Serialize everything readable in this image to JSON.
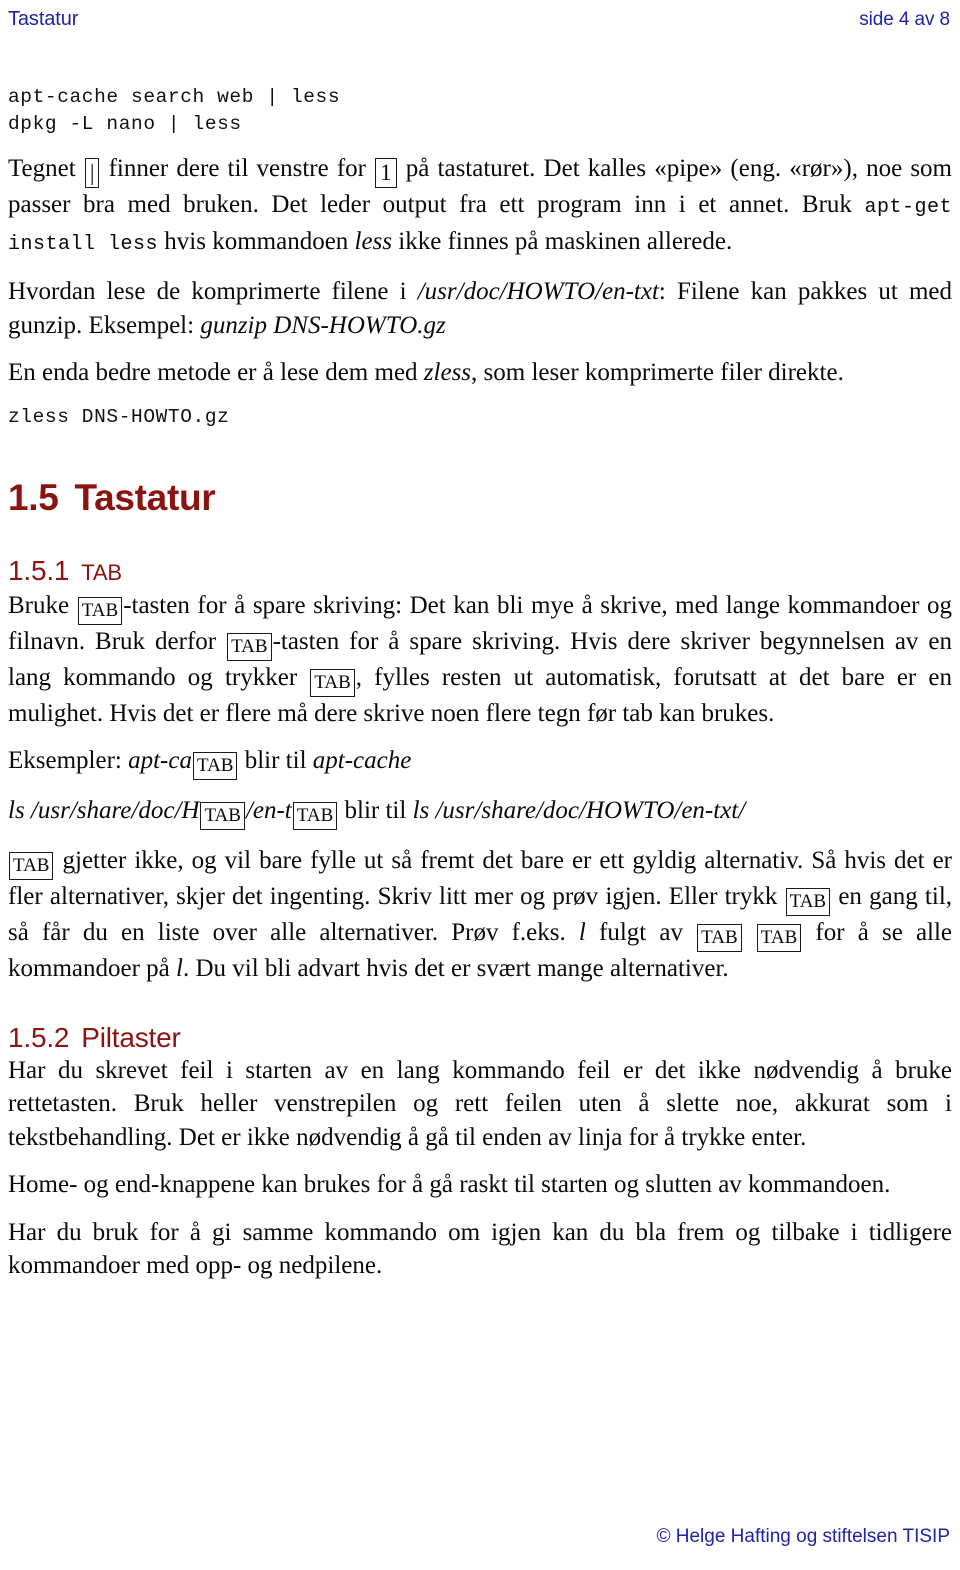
{
  "header": {
    "left_title": "Tastatur",
    "right_page": "side 4 av 8"
  },
  "code_block_1": {
    "line1": "apt-cache search web | less",
    "line2": "dpkg -L nano | less"
  },
  "paragraphs": {
    "p1_a": "Tegnet",
    "p1_key_pipe": "|",
    "p1_b": "finner dere til venstre for",
    "p1_key_one": "1",
    "p1_c": "på tastaturet. Det kalles «pipe» (eng. «rør»), noe som passer bra med bruken. Det leder output fra ett program inn i et annet. Bruk",
    "p1_code1": "apt-get install less",
    "p1_d": "hvis kommandoen",
    "p1_em1": "less",
    "p1_e": "ikke finnes på maskinen allerede.",
    "p2_a": "Hvordan lese de komprimerte filene i",
    "p2_em1": "/usr/doc/HOWTO/en-txt",
    "p2_b": ": Filene kan pakkes ut med gunzip. Eksempel:",
    "p2_em2": "gunzip DNS-HOWTO.gz",
    "p3_a": "En enda bedre metode er å lese dem med",
    "p3_em1": "zless",
    "p3_b": ", som leser komprimerte filer direkte."
  },
  "code_block_2": {
    "line1": "zless DNS-HOWTO.gz"
  },
  "sections": {
    "tastatur": {
      "number": "1.5",
      "title": "Tastatur"
    },
    "tab": {
      "number": "1.5.1",
      "title": "TAB"
    },
    "piltaster": {
      "number": "1.5.2",
      "title": "Piltaster"
    }
  },
  "keycap": {
    "tab_label": "TAB"
  },
  "tab_section": {
    "p1_a": "Bruke",
    "p1_b": "-tasten for å spare skriving: Det kan bli mye å skrive, med lange kommandoer og filnavn. Bruk derfor",
    "p1_c": "-tasten for å spare skriving. Hvis dere skriver begynnelsen av en lang kommando og trykker",
    "p1_d": ", fylles resten ut automatisk, forutsatt at det bare er en mulighet. Hvis det er flere må dere skrive noen flere tegn før tab kan brukes.",
    "ex1_label": "Eksempler:",
    "ex1_pre": "apt-ca",
    "ex1_mid": "blir til",
    "ex1_result": "apt-cache",
    "ex2_pre": "ls /usr/share/doc/H",
    "ex2_mid1": "/en-t",
    "ex2_mid2": "blir til",
    "ex2_result": "ls /usr/share/doc/HOWTO/en-txt/",
    "p2_a": "gjetter ikke, og vil bare fylle ut så fremt det bare er ett gyldig alternativ. Så hvis det er fler alternativer, skjer det ingenting. Skriv litt mer og prøv igjen. Eller trykk",
    "p2_b": "en gang til, så får du en liste over alle alternativer. Prøv f.eks.",
    "p2_em_l": "l",
    "p2_c": "fulgt av",
    "p2_d": "for å se alle kommandoer på",
    "p2_em_l2": "l",
    "p2_e": ". Du vil bli advart hvis det er svært mange alternativer."
  },
  "piltaster_section": {
    "p1": "Har du skrevet feil i starten av en lang kommando feil er det ikke nødvendig å bruke rettetasten. Bruk heller venstrepilen og rett feilen uten å slette noe, akkurat som i tekstbehandling. Det er ikke nødvendig å gå til enden av linja for å trykke enter.",
    "p2": "Home- og end-knappene kan brukes for å gå raskt til starten og slutten av kommandoen.",
    "p3": "Har du bruk for å gi samme kommando om igjen kan du bla frem og tilbake i tidligere kommandoer med opp- og nedpilene."
  },
  "footer": {
    "copyright": "© Helge Hafting og stiftelsen TISIP"
  },
  "colors": {
    "header_blue": "#2222a8",
    "heading_red": "#8c1410",
    "body_black": "#0a0a0a"
  }
}
